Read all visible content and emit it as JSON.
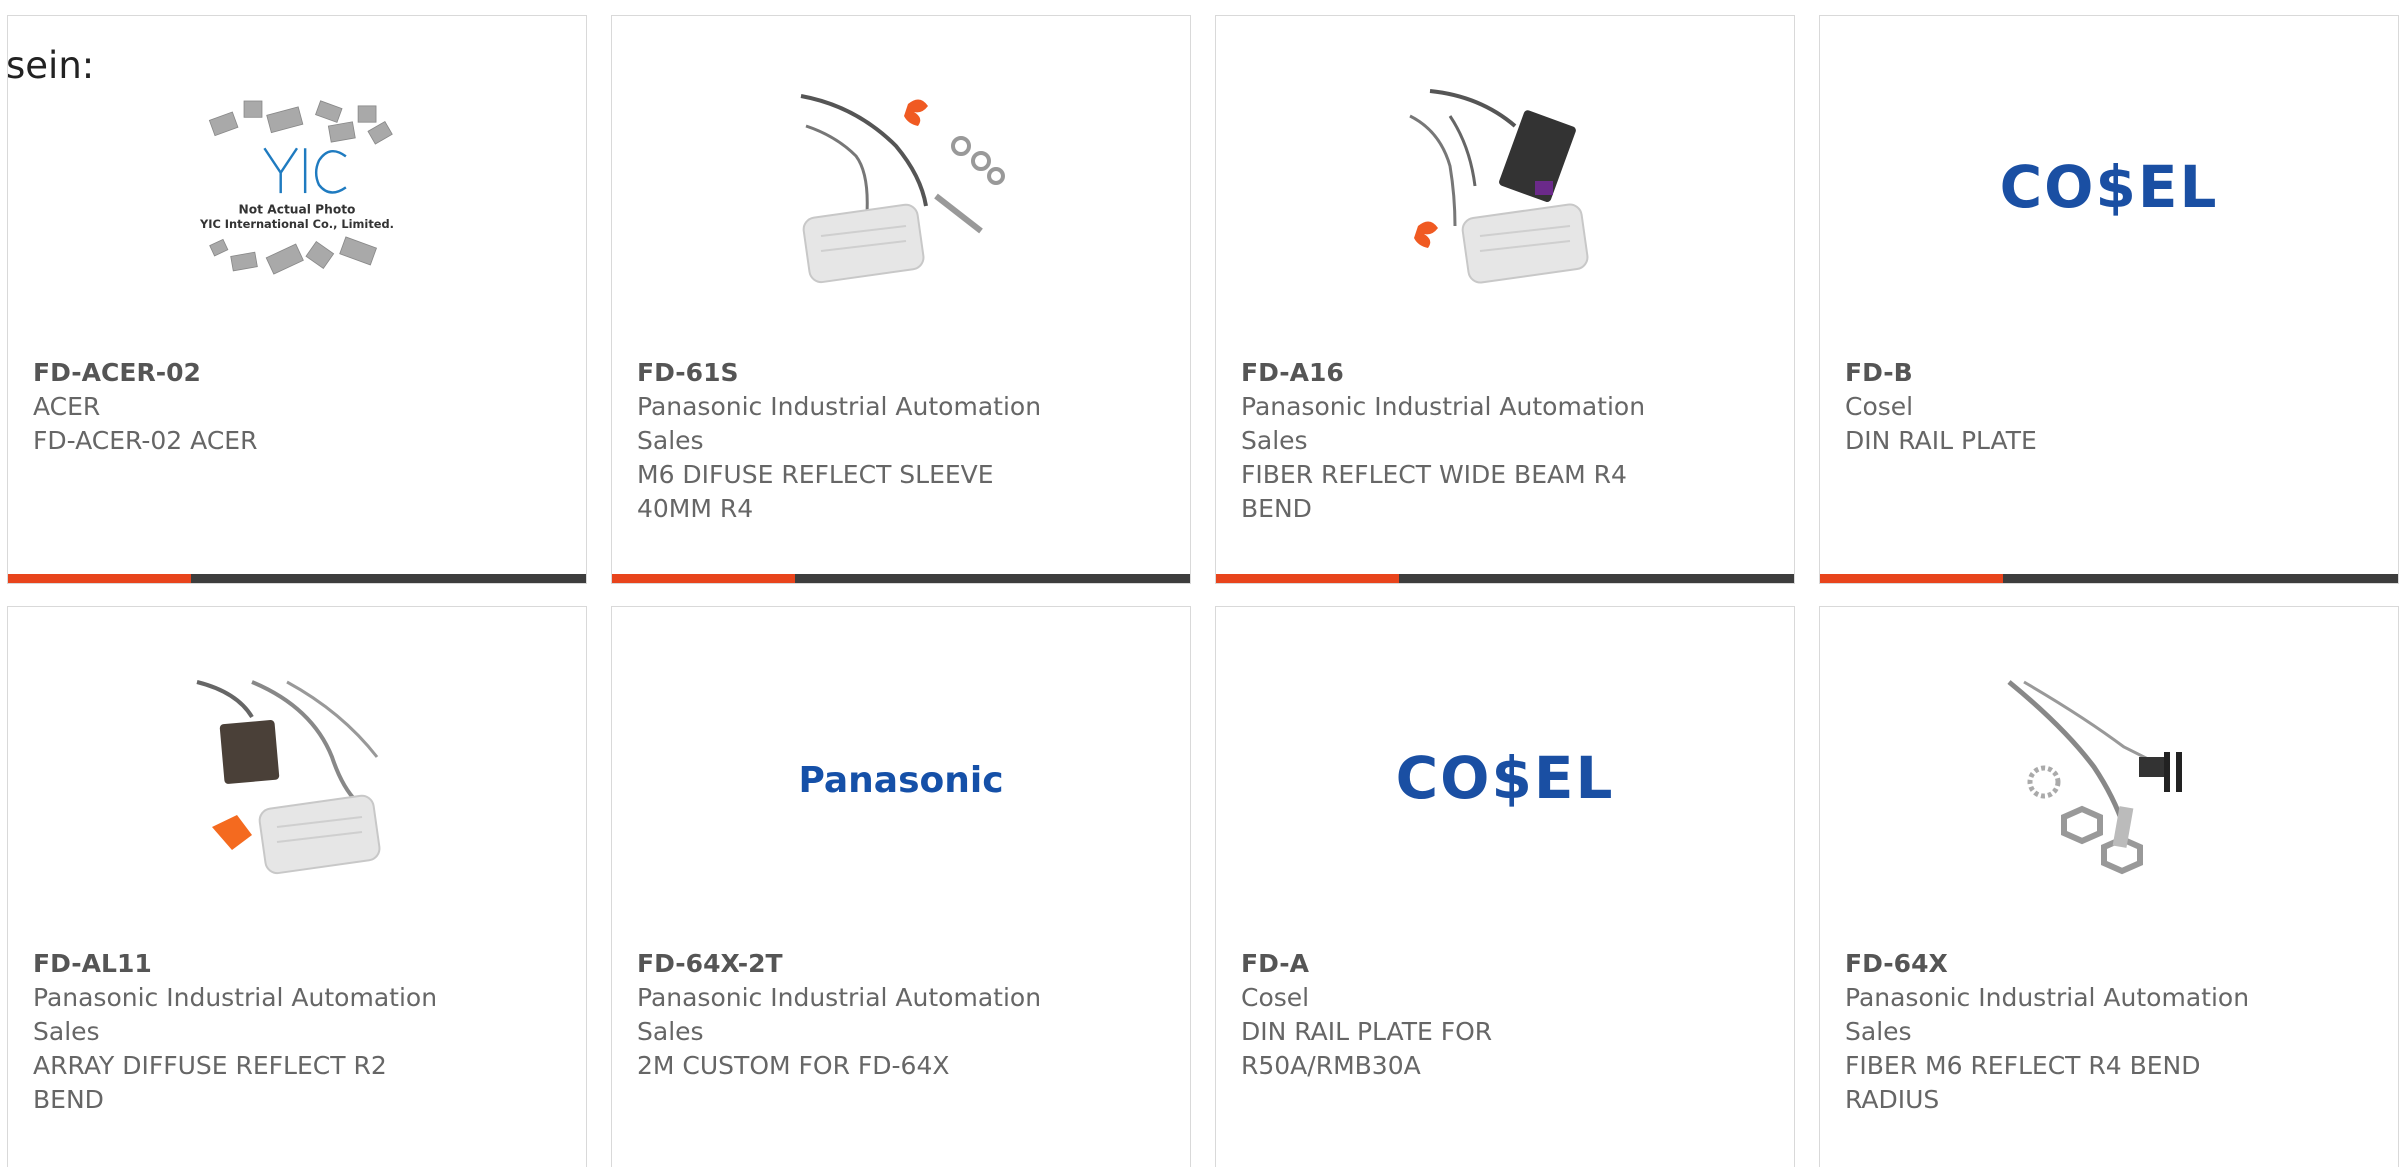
{
  "stray_text": "sein:",
  "colors": {
    "accent_bar": "#e8441c",
    "dark_bar": "#3d3d3d",
    "cosel_blue": "#1a4fa3",
    "panasonic_blue": "#1550a8"
  },
  "products": [
    {
      "part_number": "FD-ACER-02",
      "manufacturer": "ACER",
      "description": "FD-ACER-02 ACER",
      "image": "yic-placeholder",
      "image_caption_1": "Not Actual Photo",
      "image_caption_2": "YIC International Co., Limited.",
      "image_logo": "YIC"
    },
    {
      "part_number": "FD-61S",
      "manufacturer": "Panasonic Industrial Automation Sales",
      "description": "M6 DIFUSE REFLECT SLEEVE 40MM R4",
      "image": "fiber-sensor-sleeve-photo"
    },
    {
      "part_number": "FD-A16",
      "manufacturer": "Panasonic Industrial Automation Sales",
      "description": "FIBER REFLECT WIDE BEAM R4 BEND",
      "image": "fiber-sensor-wide-beam-photo"
    },
    {
      "part_number": "FD-B",
      "manufacturer": "Cosel",
      "description": "DIN RAIL PLATE",
      "image": "cosel-logo",
      "logo_text": "CO$EL"
    },
    {
      "part_number": "FD-AL11",
      "manufacturer": "Panasonic Industrial Automation Sales",
      "description": "ARRAY DIFFUSE REFLECT R2 BEND",
      "image": "fiber-sensor-array-photo"
    },
    {
      "part_number": "FD-64X-2T",
      "manufacturer": "Panasonic Industrial Automation Sales",
      "description": "2M CUSTOM FOR FD-64X",
      "image": "panasonic-logo",
      "logo_text": "Panasonic"
    },
    {
      "part_number": "FD-A",
      "manufacturer": "Cosel",
      "description": "DIN RAIL PLATE FOR R50A/RMB30A",
      "image": "cosel-logo",
      "logo_text": "CO$EL"
    },
    {
      "part_number": "FD-64X",
      "manufacturer": "Panasonic Industrial Automation Sales",
      "description": "FIBER M6 REFLECT R4 BEND RADIUS",
      "image": "fiber-sensor-m6-photo"
    }
  ]
}
